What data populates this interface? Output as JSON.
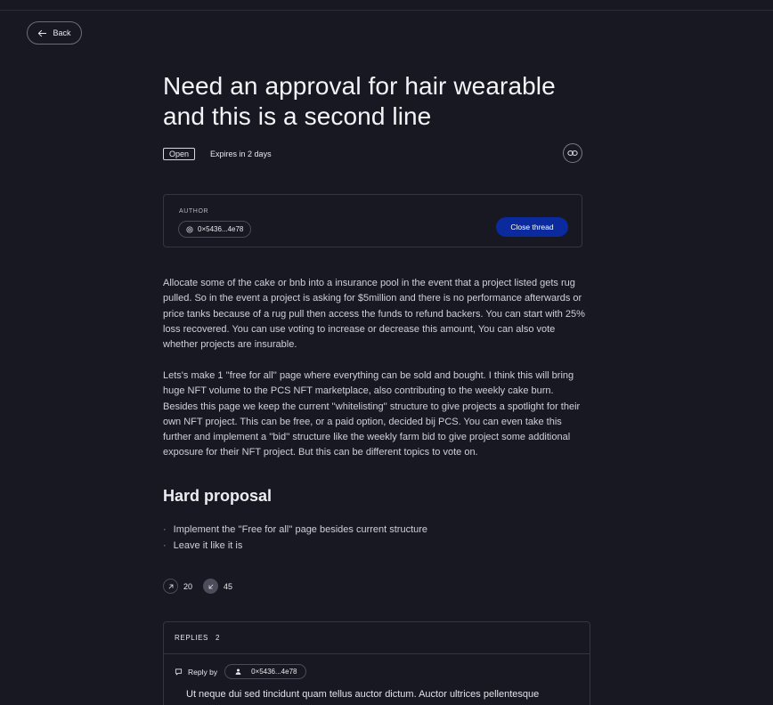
{
  "nav": {
    "back_label": "Back"
  },
  "proposal": {
    "title": "Need an approval for hair wearable and this is a second line",
    "status": "Open",
    "expires": "Expires in 2 days"
  },
  "author": {
    "label": "AUTHOR",
    "address": "0×5436...4e78",
    "close_label": "Close thread"
  },
  "body": {
    "paragraph1": "Allocate some of the cake or bnb into a insurance pool in the event that a project listed gets rug pulled. So in the event a project is asking for $5million and there is no performance afterwards or price tanks because of a rug pull then access the funds to refund backers. You can start with 25% loss recovered. You can use voting to increase or decrease this amount, You can also vote whether projects are insurable.",
    "paragraph2": "Lets's make 1 ''free for all'' page where everything can be sold and bought. I think this will bring huge NFT volume to the PCS NFT marketplace, also contributing to the weekly cake burn. Besides this page we keep the current ''whitelisting'' structure to give projects a spotlight for their own NFT project. This can be free, or a paid option, decided bij PCS. You can even take this further and implement a ''bid'' structure like the weekly farm bid to give project some additional exposure for their NFT project. But this can be different topics to vote on.",
    "section_title": "Hard proposal",
    "options": [
      "Implement the ''Free for all'' page besides current structure",
      "Leave it like it is"
    ],
    "bullet": "·"
  },
  "votes": {
    "up": "20",
    "down": "45"
  },
  "replies": {
    "label": "REPLIES",
    "count": "2",
    "reply_by": "Reply by",
    "reply_address": "0×5436...4e78",
    "first_reply_text": "Ut neque dui sed tincidunt quam tellus auctor dictum. Auctor ultrices pellentesque"
  },
  "icons": {
    "back": "arrow-left-icon",
    "link": "link-icon",
    "address": "at-icon",
    "upvote": "arrow-up-right-icon",
    "downvote": "arrow-down-left-icon",
    "comment": "comment-icon",
    "user": "user-icon"
  },
  "colors": {
    "background": "#171821",
    "accent": "#0a2a9e",
    "border": "#343541"
  }
}
